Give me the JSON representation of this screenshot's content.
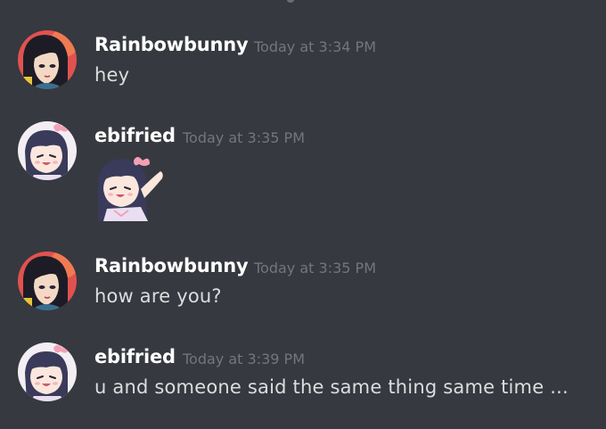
{
  "messages": [
    {
      "username": "Rainbowbunny",
      "timestamp": "Today at 3:34 PM",
      "text": "hey",
      "avatar": "rainbowbunny-avatar"
    },
    {
      "username": "ebifried",
      "timestamp": "Today at 3:35 PM",
      "text": "",
      "avatar": "ebifried-avatar",
      "attachment": "chibi-sticker"
    },
    {
      "username": "Rainbowbunny",
      "timestamp": "Today at 3:35 PM",
      "text": "how are you?",
      "avatar": "rainbowbunny-avatar"
    },
    {
      "username": "ebifried",
      "timestamp": "Today at 3:39 PM",
      "text": "u and someone said the same thing same time ...",
      "avatar": "ebifried-avatar"
    }
  ],
  "colors": {
    "background": "#36393f",
    "username": "#ffffff",
    "timestamp": "#72767d",
    "message_text": "#dcddde"
  }
}
